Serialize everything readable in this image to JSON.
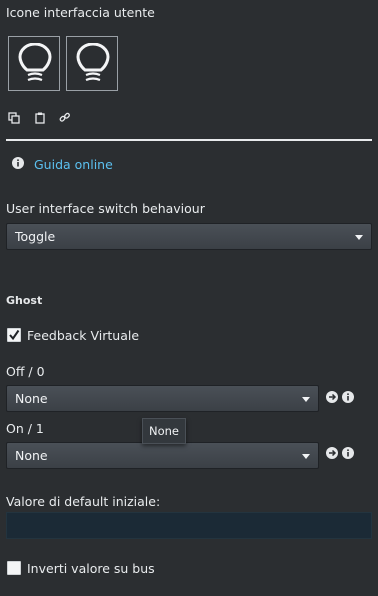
{
  "ui_icons": {
    "title": "Icone interfaccia utente",
    "icons": [
      "lightbulb-icon",
      "lightbulb-icon"
    ]
  },
  "help": {
    "link_label": "Guida online"
  },
  "switch_behaviour": {
    "label": "User interface switch behaviour",
    "value": "Toggle"
  },
  "ghost": {
    "title": "Ghost",
    "virtual_feedback": {
      "label": "Feedback Virtuale",
      "checked": true
    },
    "off": {
      "label": "Off / 0",
      "value": "None"
    },
    "tooltip": "None",
    "on": {
      "label": "On / 1",
      "value": "None"
    },
    "default_value": {
      "label": "Valore di default iniziale:",
      "value": ""
    },
    "invert": {
      "label": "Inverti valore su bus",
      "checked": false
    }
  },
  "colors": {
    "background": "#2b2e31",
    "link": "#5bc0f0",
    "input_bg": "#1b2a36"
  }
}
